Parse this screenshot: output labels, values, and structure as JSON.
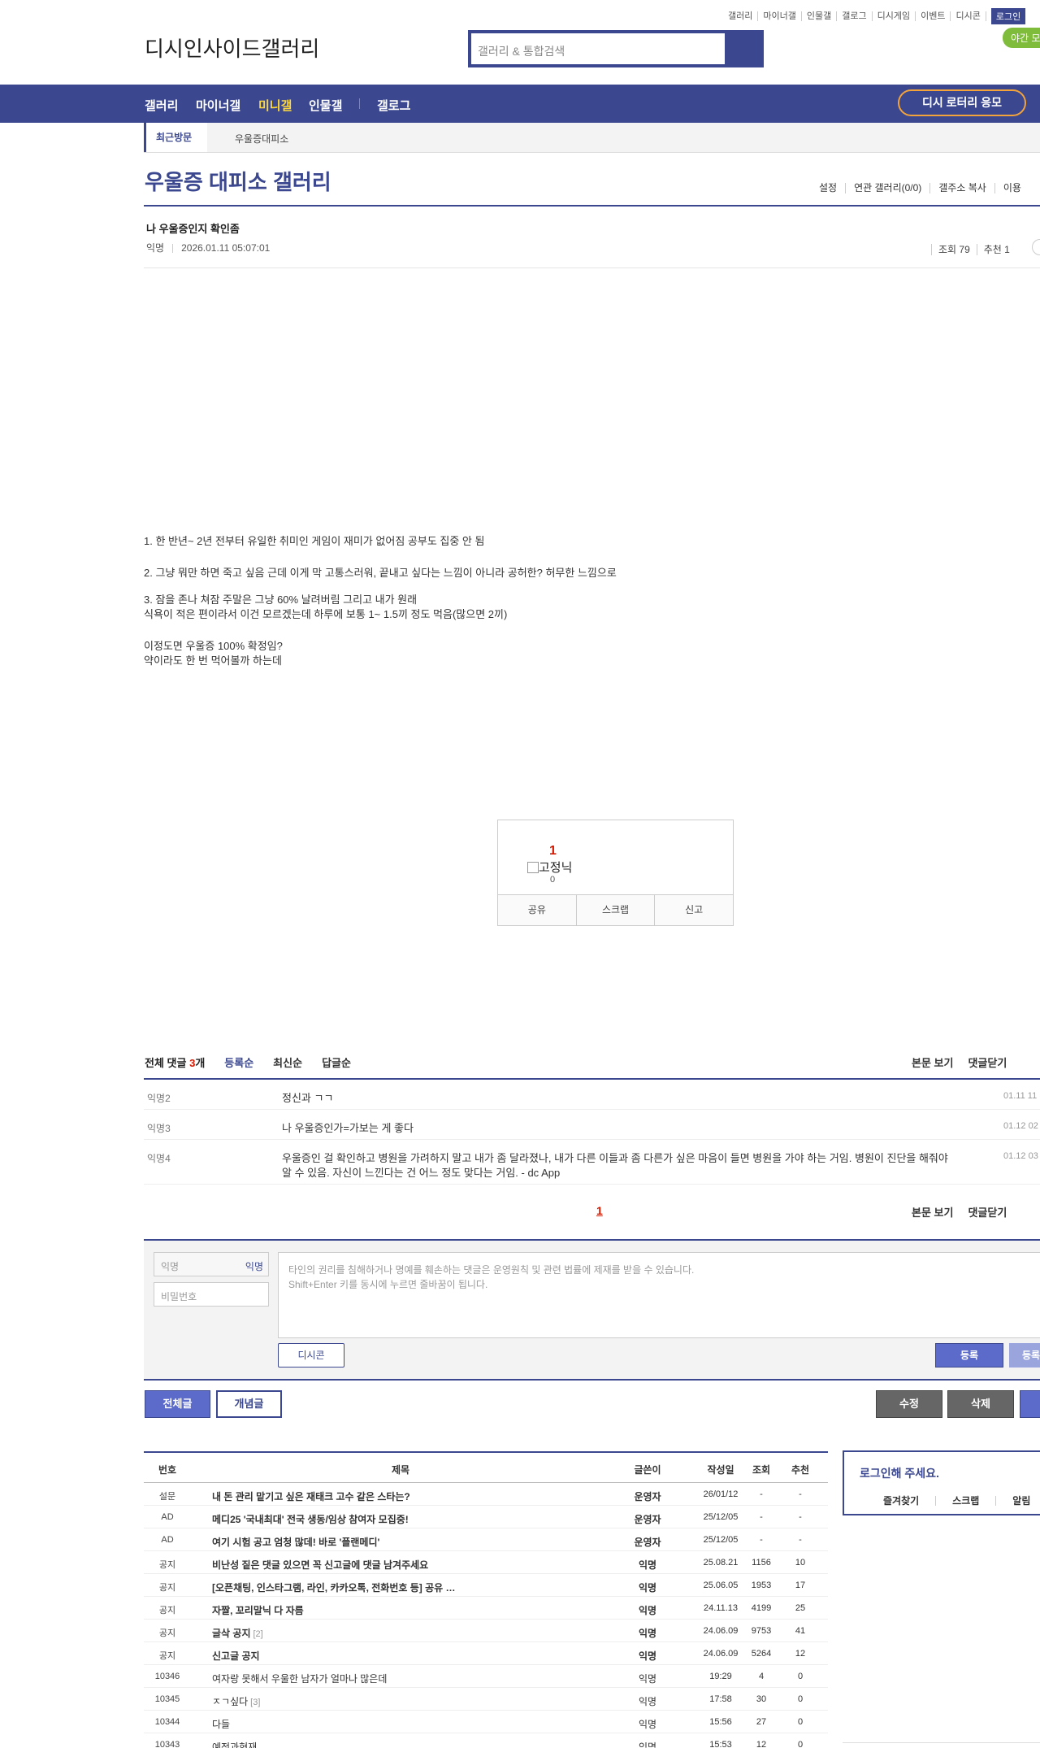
{
  "top_links": [
    "갤러리",
    "마이너갤",
    "인물갤",
    "갤로그",
    "디시게임",
    "이벤트",
    "디시콘"
  ],
  "login_label": "로그인",
  "night_mode_label": "야간 모드",
  "logo": {
    "site": "디시인사이드",
    "section": "갤러리"
  },
  "search": {
    "placeholder": "갤러리 & 통합검색"
  },
  "gnb": {
    "items": [
      "갤러리",
      "마이너갤",
      "미니갤",
      "인물갤",
      "갤로그"
    ],
    "active": "미니갤",
    "lottery_label": "디시 로터리 응모"
  },
  "recent": {
    "label": "최근방문",
    "item": "우울증대피소"
  },
  "gallery": {
    "title": "우울증 대피소 갤러리",
    "options": [
      "설정",
      "연관 갤러리(0/0)",
      "갤주소 복사",
      "이용"
    ]
  },
  "post": {
    "title": "나 우울증인지 확인좀",
    "writer": "익명",
    "date": "2026.01.11 05:07:01",
    "views_label": "조회 79",
    "recommend_label": "추천 1",
    "body": [
      "1. 한 반년~ 2년 전부터 유일한 취미인 게임이 재미가 없어짐 공부도 집중 안 됨",
      "2. 그냥 뭐만 하면 죽고 싶음 근데 이게 막 고통스러워, 끝내고 싶다는 느낌이 아니라 공허한? 허무한 느낌으로",
      "3. 잠을 존나 쳐잠 주말은 그냥 60% 날려버림 그리고 내가 원래",
      "식욕이 적은 편이라서 이건 모르겠는데 하루에 보통 1~ 1.5끼 정도 먹음(많으면 2끼)",
      "이정도면 우울증 100% 확정임?",
      "약이라도 한 번 먹어볼까 하는데"
    ]
  },
  "recommend_box": {
    "count": "1",
    "fixed_label": "고정닉",
    "fixed_count": "0",
    "buttons": [
      "공유",
      "스크랩",
      "신고"
    ]
  },
  "comments": {
    "total_label": "전체 댓글 ",
    "total_count": "3",
    "total_unit": "개",
    "sorts": [
      "등록순",
      "최신순",
      "답글순"
    ],
    "right_links": [
      "본문 보기",
      "댓글닫기"
    ],
    "page": "1",
    "items": [
      {
        "nick": "익명2",
        "text": "정신과 ㄱㄱ",
        "date": "01.11 11"
      },
      {
        "nick": "익명3",
        "text": "나 우울증인가=가보는 게 좋다",
        "date": "01.12 02"
      },
      {
        "nick": "익명4",
        "text": "우울증인 걸 확인하고 병원을 가려하지 말고 내가 좀 달라졌나, 내가 다른 이들과 좀 다른가 싶은 마음이 들면 병원을 가야 하는 거임. 병원이 진단을 해줘야 알 수 있음. 자신이 느낀다는 건 어느 정도 맞다는 거임. - dc App",
        "date": "01.12 03"
      }
    ]
  },
  "write": {
    "name_placeholder": "익명",
    "name_tag": "익명",
    "password_placeholder": "비밀번호",
    "memo_line1": "타인의 권리를 침해하거나 명예를 훼손하는 댓글은 운영원칙 및 관련 법률에 제재를 받을 수 있습니다.",
    "memo_line2": "Shift+Enter 키를 동시에 누르면 줄바꿈이 됩니다.",
    "dccon_label": "디시콘",
    "register_label": "등록",
    "register2_label": "등록"
  },
  "actions": {
    "all": "전체글",
    "best": "개념글",
    "edit": "수정",
    "delete": "삭제"
  },
  "list": {
    "headers": {
      "no": "번호",
      "subject": "제목",
      "writer": "글쓴이",
      "date": "작성일",
      "views": "조회",
      "recommend": "추천"
    },
    "rows": [
      {
        "no": "설문",
        "subject": "내 돈 관리 맡기고 싶은 재태크 고수 같은 스타는?",
        "reply": "",
        "writer": "운영자",
        "date": "26/01/12",
        "views": "-",
        "rec": "-",
        "bold": true
      },
      {
        "no": "AD",
        "subject": "메디25 '국내최대' 전국 생동/임상 참여자 모집중!",
        "reply": "",
        "writer": "운영자",
        "date": "25/12/05",
        "views": "-",
        "rec": "-",
        "bold": true
      },
      {
        "no": "AD",
        "subject": "여기 시험 공고 엄청 많데! 바로 '플랜메디'",
        "reply": "",
        "writer": "운영자",
        "date": "25/12/05",
        "views": "-",
        "rec": "-",
        "bold": true
      },
      {
        "no": "공지",
        "subject": "비난성 짙은 댓글 있으면 꼭 신고글에 댓글 남겨주세요",
        "reply": "",
        "writer": "익명",
        "date": "25.08.21",
        "views": "1156",
        "rec": "10",
        "bold": true
      },
      {
        "no": "공지",
        "subject": "[오픈채팅, 인스타그램, 라인, 카카오톡, 전화번호 등] 공유 …",
        "reply": "",
        "writer": "익명",
        "date": "25.06.05",
        "views": "1953",
        "rec": "17",
        "bold": true
      },
      {
        "no": "공지",
        "subject": "자짤, 꼬리말닉 다 자름",
        "reply": "",
        "writer": "익명",
        "date": "24.11.13",
        "views": "4199",
        "rec": "25",
        "bold": true
      },
      {
        "no": "공지",
        "subject": "글삭 공지",
        "reply": "[2]",
        "writer": "익명",
        "date": "24.06.09",
        "views": "9753",
        "rec": "41",
        "bold": true
      },
      {
        "no": "공지",
        "subject": "신고글 공지",
        "reply": "",
        "writer": "익명",
        "date": "24.06.09",
        "views": "5264",
        "rec": "12",
        "bold": true
      },
      {
        "no": "10346",
        "subject": "여자랑 못해서 우울한 남자가 얼마나 많은데",
        "reply": "",
        "writer": "익명",
        "date": "19:29",
        "views": "4",
        "rec": "0",
        "bold": false
      },
      {
        "no": "10345",
        "subject": "ㅈㄱ싶다",
        "reply": "[3]",
        "writer": "익명",
        "date": "17:58",
        "views": "30",
        "rec": "0",
        "bold": false
      },
      {
        "no": "10344",
        "subject": "다들",
        "reply": "",
        "writer": "익명",
        "date": "15:56",
        "views": "27",
        "rec": "0",
        "bold": false
      },
      {
        "no": "10343",
        "subject": "예전과현재",
        "reply": "",
        "writer": "익명",
        "date": "15:53",
        "views": "12",
        "rec": "0",
        "bold": false
      }
    ]
  },
  "sidebar": {
    "login_title": "로그인해 주세요.",
    "links": [
      "즐겨찾기",
      "스크랩",
      "알림"
    ]
  }
}
